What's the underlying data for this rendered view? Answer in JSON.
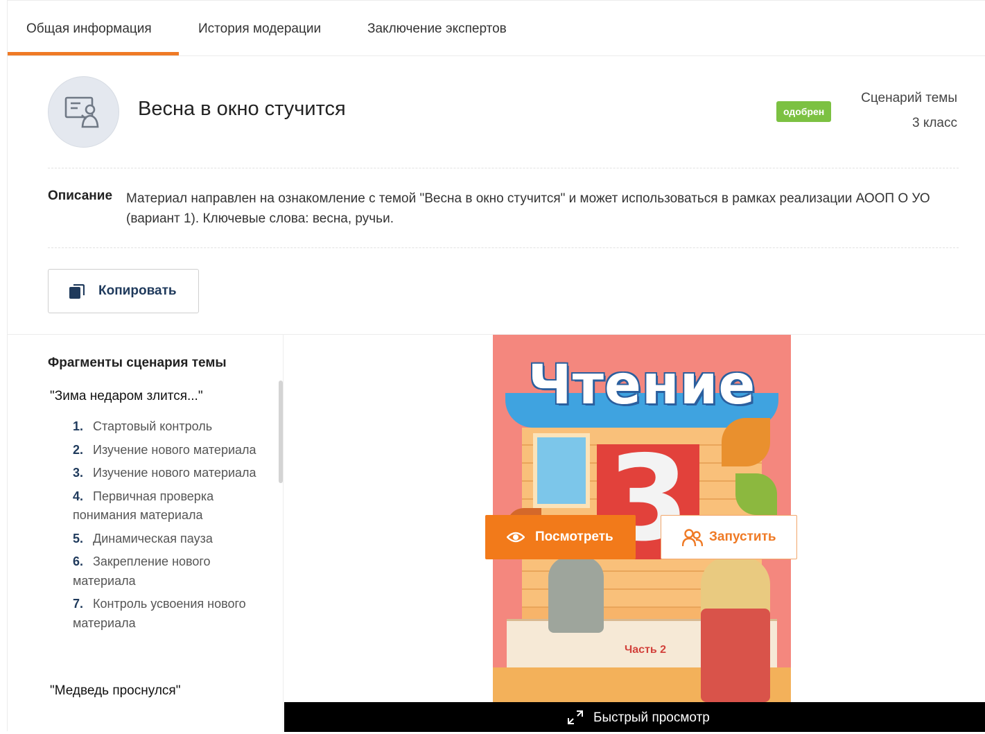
{
  "tabs": [
    {
      "label": "Общая информация",
      "active": true
    },
    {
      "label": "История модерации",
      "active": false
    },
    {
      "label": "Заключение экспертов",
      "active": false
    }
  ],
  "header": {
    "title": "Весна в окно стучится",
    "status": "одобрен",
    "type": "Сценарий темы",
    "grade": "3 класс",
    "avatar_icon": "lesson-scenario-icon"
  },
  "description": {
    "label": "Описание",
    "text": "Материал направлен на ознакомление с темой \"Весна в окно стучится\" и может использоваться в рамках реализации АООП О УО (вариант 1). Ключевые слова: весна, ручьи."
  },
  "actions": {
    "copy_label": "Копировать",
    "copy_icon": "copy-icon"
  },
  "sidebar": {
    "title": "Фрагменты сценария темы",
    "groups": [
      {
        "title": "\"Зима недаром злится...\"",
        "items": [
          {
            "num": "1.",
            "label": "Стартовый контроль"
          },
          {
            "num": "2.",
            "label": "Изучение нового материала"
          },
          {
            "num": "3.",
            "label": "Изучение нового материала"
          },
          {
            "num": "4.",
            "label": "Первичная проверка понимания материала"
          },
          {
            "num": "5.",
            "label": "Динамическая пауза"
          },
          {
            "num": "6.",
            "label": "Закрепление нового материала"
          },
          {
            "num": "7.",
            "label": "Контроль усвоения нового материала"
          }
        ]
      },
      {
        "title": "\"Медведь проснулся\"",
        "items": []
      }
    ]
  },
  "preview": {
    "cover_title": "Чтение",
    "cover_grade": "3",
    "cover_part": "Часть 2",
    "view_label": "Посмотреть",
    "run_label": "Запустить",
    "quick_view_label": "Быстрый просмотр"
  },
  "colors": {
    "accent": "#ef7a25",
    "status_green": "#7cc142",
    "heading_navy": "#1f3a5c"
  }
}
